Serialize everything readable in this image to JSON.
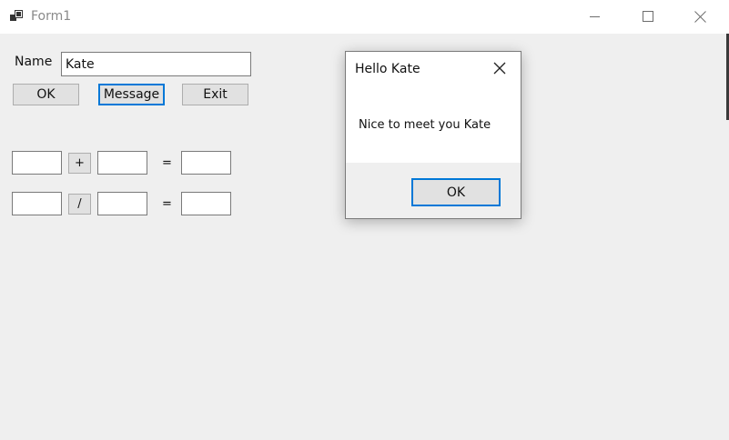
{
  "window": {
    "title": "Form1",
    "icon": "windows-form-icon"
  },
  "form": {
    "name_label": "Name",
    "name_value": "Kate",
    "ok_button": "OK",
    "message_button": "Message",
    "exit_button": "Exit",
    "add_operator": "+",
    "divide_operator": "/",
    "equals_1": "=",
    "equals_2": "=",
    "add_left_value": "",
    "add_right_value": "",
    "add_result_value": "",
    "div_left_value": "",
    "div_right_value": "",
    "div_result_value": ""
  },
  "dialog": {
    "title": "Hello Kate",
    "message": "Nice to meet you Kate",
    "ok_button": "OK"
  },
  "colors": {
    "accent": "#0078d7",
    "background": "#efefef",
    "button_face": "#e1e1e1"
  }
}
